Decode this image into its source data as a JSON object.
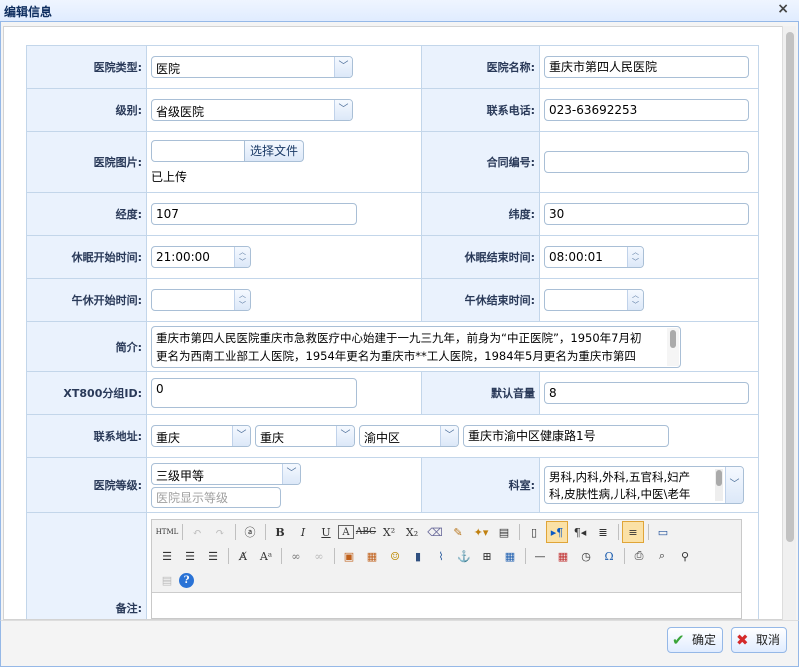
{
  "window": {
    "title": "编辑信息",
    "close": "×"
  },
  "form": {
    "hospital_type": {
      "label": "医院类型:",
      "value": "医院"
    },
    "hospital_name": {
      "label": "医院名称:",
      "value": "重庆市第四人民医院"
    },
    "level": {
      "label": "级别:",
      "value": "省级医院"
    },
    "phone": {
      "label": "联系电话:",
      "value": "023-63692253"
    },
    "image": {
      "label": "医院图片:",
      "button": "选择文件",
      "status": "已上传"
    },
    "contract": {
      "label": "合同编号:",
      "value": ""
    },
    "longitude": {
      "label": "经度:",
      "value": "107"
    },
    "latitude": {
      "label": "纬度:",
      "value": "30"
    },
    "sleep_start": {
      "label": "休眠开始时间:",
      "value": "21:00:00"
    },
    "sleep_end": {
      "label": "休眠结束时间:",
      "value": "08:00:01"
    },
    "noon_start": {
      "label": "午休开始时间:",
      "value": ""
    },
    "noon_end": {
      "label": "午休结束时间:",
      "value": ""
    },
    "intro": {
      "label": "简介:",
      "line1": "重庆市第四人民医院重庆市急救医疗中心始建于一九三九年，前身为“中正医院”，1950年7月初",
      "line2": "更名为西南工业部工人医院，1954年更名为重庆市**工人医院，1984年5月更名为重庆市第四"
    },
    "xt800": {
      "label": "XT800分组ID:",
      "value": "0"
    },
    "volume": {
      "label": "默认音量",
      "value": "8"
    },
    "address": {
      "label": "联系地址:",
      "province": "重庆",
      "city": "重庆",
      "district": "渝中区",
      "detail": "重庆市渝中区健康路1号"
    },
    "grade": {
      "label": "医院等级:",
      "value": "三级甲等",
      "placeholder": "医院显示等级"
    },
    "dept": {
      "label": "科室:",
      "line1": "男科,内科,外科,五官科,妇产",
      "line2": "科,皮肤性病,儿科,中医\\老年"
    },
    "remark": {
      "label": "备注:"
    }
  },
  "toolbar": {
    "row1": [
      "HTML",
      "undo",
      "redo",
      "@",
      "B",
      "I",
      "U",
      "A",
      "ABC",
      "X²",
      "X₂",
      "eraser",
      "brush",
      "wand",
      "paste",
      "page",
      "ltr",
      "rtl",
      "indent",
      "align-left",
      "monitor"
    ],
    "row2": [
      "justify-left",
      "justify-center",
      "justify-full",
      "font",
      "font-size",
      "link",
      "unlink",
      "image",
      "gallery",
      "emoticon",
      "video",
      "attach",
      "anchor",
      "insert-table",
      "table",
      "hr",
      "date",
      "time",
      "Ω",
      "print",
      "preview",
      "search",
      "paste-word",
      "help"
    ]
  },
  "footer": {
    "ok": "确定",
    "cancel": "取消"
  }
}
